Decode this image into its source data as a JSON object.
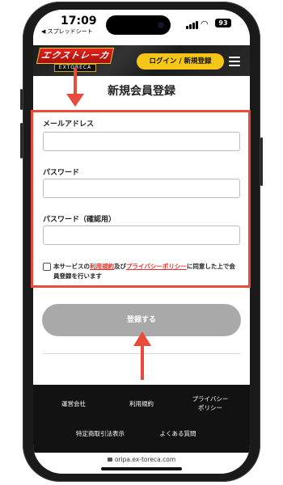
{
  "status_bar": {
    "time": "17:09",
    "back_app": "◀ スプレッドシート",
    "battery": "93"
  },
  "header": {
    "logo_main": "エクストレーカ",
    "logo_sub": "EXTORECA",
    "login_label": "ログイン / 新規登録"
  },
  "page": {
    "title": "新規会員登録"
  },
  "form": {
    "email_label": "メールアドレス",
    "email_value": "",
    "password_label": "パスワード",
    "password_value": "",
    "confirm_label": "パスワード（確認用）",
    "confirm_value": "",
    "agree": {
      "prefix": "本サービスの",
      "terms_link": "利用規約",
      "and": "及び",
      "privacy_link": "プライバシーポリシー",
      "suffix": "に同意した上で会員登録を行います"
    },
    "submit_label": "登録する"
  },
  "footer": {
    "company": "運営会社",
    "terms": "利用規約",
    "privacy": "プライバシー\nポリシー",
    "commerce": "特定商取引法表示",
    "faq": "よくある質問"
  },
  "browser": {
    "url": "oripa.ex-toreca.com"
  },
  "colors": {
    "annotation_red": "#e84a3c",
    "login_yellow": "#f5c518",
    "link_red": "#e0302a",
    "submit_gray": "#a9a9a9",
    "footer_bg": "#121212"
  }
}
